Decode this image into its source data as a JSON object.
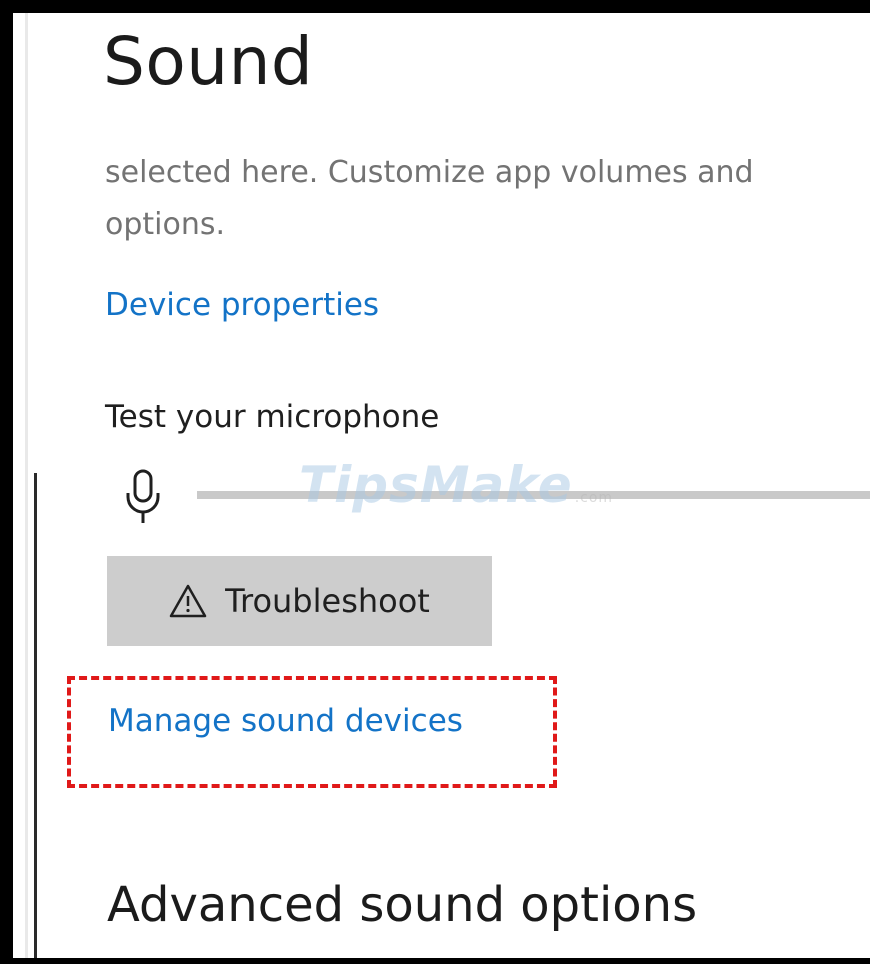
{
  "page": {
    "title": "Sound",
    "description_lines": [
      "selected here. Customize app volumes and",
      "options."
    ]
  },
  "links": {
    "device_properties": "Device properties",
    "manage_sound_devices": "Manage sound devices"
  },
  "microphone": {
    "test_label": "Test your microphone",
    "icon": "microphone-icon",
    "level_percent": 0
  },
  "troubleshoot": {
    "label": "Troubleshoot",
    "icon": "warning-triangle-icon"
  },
  "advanced": {
    "title": "Advanced sound options"
  },
  "watermark": {
    "text": "TipsMake",
    "suffix": ".com"
  },
  "colors": {
    "link": "#1373c7",
    "highlight": "#e01919",
    "button_bg": "#cdcdcd"
  }
}
